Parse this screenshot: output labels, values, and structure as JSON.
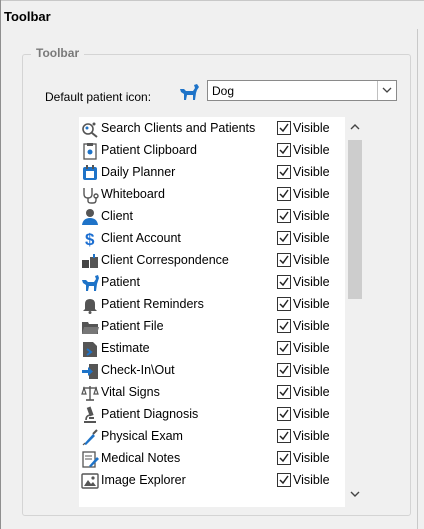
{
  "page": {
    "title": "Toolbar"
  },
  "group": {
    "legend": "Toolbar"
  },
  "default_icon": {
    "label": "Default patient icon:",
    "value": "Dog",
    "icon": "dog-icon"
  },
  "toolbar_items": [
    {
      "label": "Search Clients and Patients",
      "icon": "search-pets-icon",
      "visible_label": "Visible",
      "checked": true
    },
    {
      "label": "Patient Clipboard",
      "icon": "clipboard-icon",
      "visible_label": "Visible",
      "checked": true
    },
    {
      "label": "Daily Planner",
      "icon": "planner-icon",
      "visible_label": "Visible",
      "checked": true
    },
    {
      "label": "Whiteboard",
      "icon": "stethoscope-icon",
      "visible_label": "Visible",
      "checked": true
    },
    {
      "label": "Client",
      "icon": "client-icon",
      "visible_label": "Visible",
      "checked": true
    },
    {
      "label": "Client Account",
      "icon": "dollar-icon",
      "visible_label": "Visible",
      "checked": true
    },
    {
      "label": "Client Correspondence",
      "icon": "mailbox-icon",
      "visible_label": "Visible",
      "checked": true
    },
    {
      "label": "Patient",
      "icon": "dog-icon",
      "visible_label": "Visible",
      "checked": true
    },
    {
      "label": "Patient Reminders",
      "icon": "bell-icon",
      "visible_label": "Visible",
      "checked": true
    },
    {
      "label": "Patient File",
      "icon": "folder-icon",
      "visible_label": "Visible",
      "checked": true
    },
    {
      "label": "Estimate",
      "icon": "estimate-icon",
      "visible_label": "Visible",
      "checked": true
    },
    {
      "label": "Check-In\\Out",
      "icon": "check-in-arrow-icon",
      "visible_label": "Visible",
      "checked": true
    },
    {
      "label": "Vital Signs",
      "icon": "scale-icon",
      "visible_label": "Visible",
      "checked": true
    },
    {
      "label": "Patient Diagnosis",
      "icon": "microscope-icon",
      "visible_label": "Visible",
      "checked": true
    },
    {
      "label": "Physical Exam",
      "icon": "syringe-icon",
      "visible_label": "Visible",
      "checked": true
    },
    {
      "label": "Medical Notes",
      "icon": "notes-icon",
      "visible_label": "Visible",
      "checked": true
    },
    {
      "label": "Image Explorer",
      "icon": "image-icon",
      "visible_label": "Visible",
      "checked": true
    }
  ],
  "colors": {
    "accent_blue": "#1e73c8",
    "icon_gray": "#6b6b6b",
    "dollar_blue": "#1d6fd1"
  }
}
